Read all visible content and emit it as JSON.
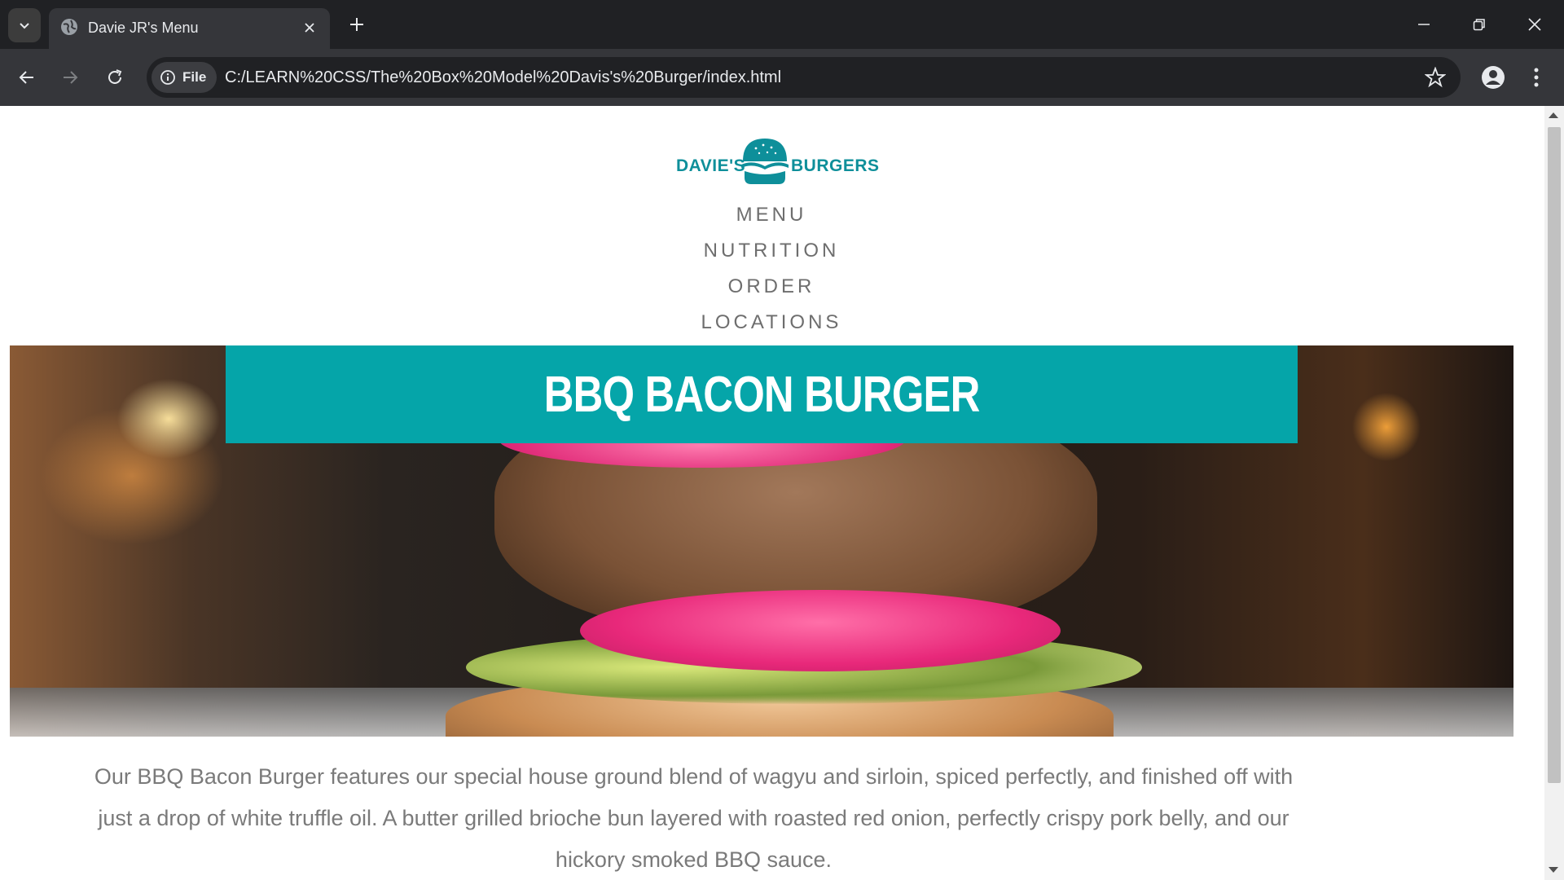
{
  "browser": {
    "tab_title": "Davie JR's Menu",
    "site_chip_label": "File",
    "url": "C:/LEARN%20CSS/The%20Box%20Model%20Davis's%20Burger/index.html"
  },
  "page": {
    "logo": {
      "left_word": "DAVIE'S",
      "right_word": "BURGERS"
    },
    "nav": [
      "MENU",
      "NUTRITION",
      "ORDER",
      "LOCATIONS"
    ],
    "hero_title": "BBQ BACON BURGER",
    "description": "Our BBQ Bacon Burger features our special house ground blend of wagyu and sirloin, spiced perfectly, and finished off with just a drop of white truffle oil. A butter grilled brioche bun layered with roasted red onion, perfectly crispy pork belly, and our hickory smoked BBQ sauce.",
    "colors": {
      "accent": "#05a5a9",
      "logo": "#0e8f9a",
      "nav_text": "#6e6e6e",
      "body_text": "#7a7a7a"
    }
  }
}
